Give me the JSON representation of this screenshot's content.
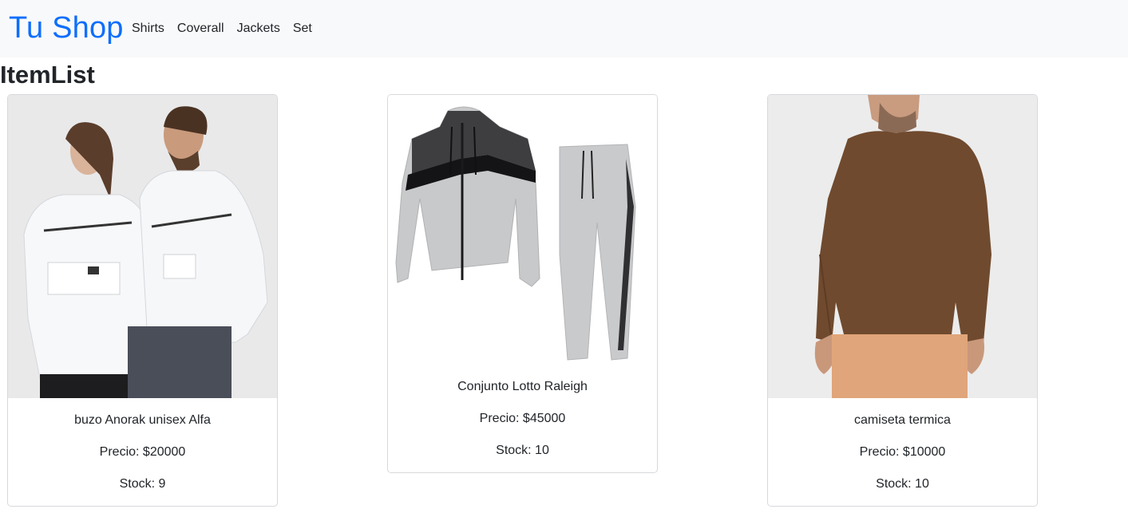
{
  "navbar": {
    "brand": "Tu Shop",
    "links": [
      "Shirts",
      "Coverall",
      "Jackets",
      "Set"
    ]
  },
  "page": {
    "title": "ItemList"
  },
  "items": [
    {
      "title": "buzo Anorak unisex Alfa",
      "price": "Precio: $20000",
      "stock": "Stock: 9",
      "image": "anorak-jackets-photo"
    },
    {
      "title": "Conjunto Lotto Raleigh",
      "price": "Precio: $45000",
      "stock": "Stock: 10",
      "image": "tracksuit-set-photo"
    },
    {
      "title": "camiseta termica",
      "price": "Precio: $10000",
      "stock": "Stock: 10",
      "image": "thermal-shirt-photo"
    }
  ],
  "colors": {
    "brand": "#0d6efd",
    "navbar_bg": "#f8f9fa",
    "card_border": "#d7d9dc"
  }
}
